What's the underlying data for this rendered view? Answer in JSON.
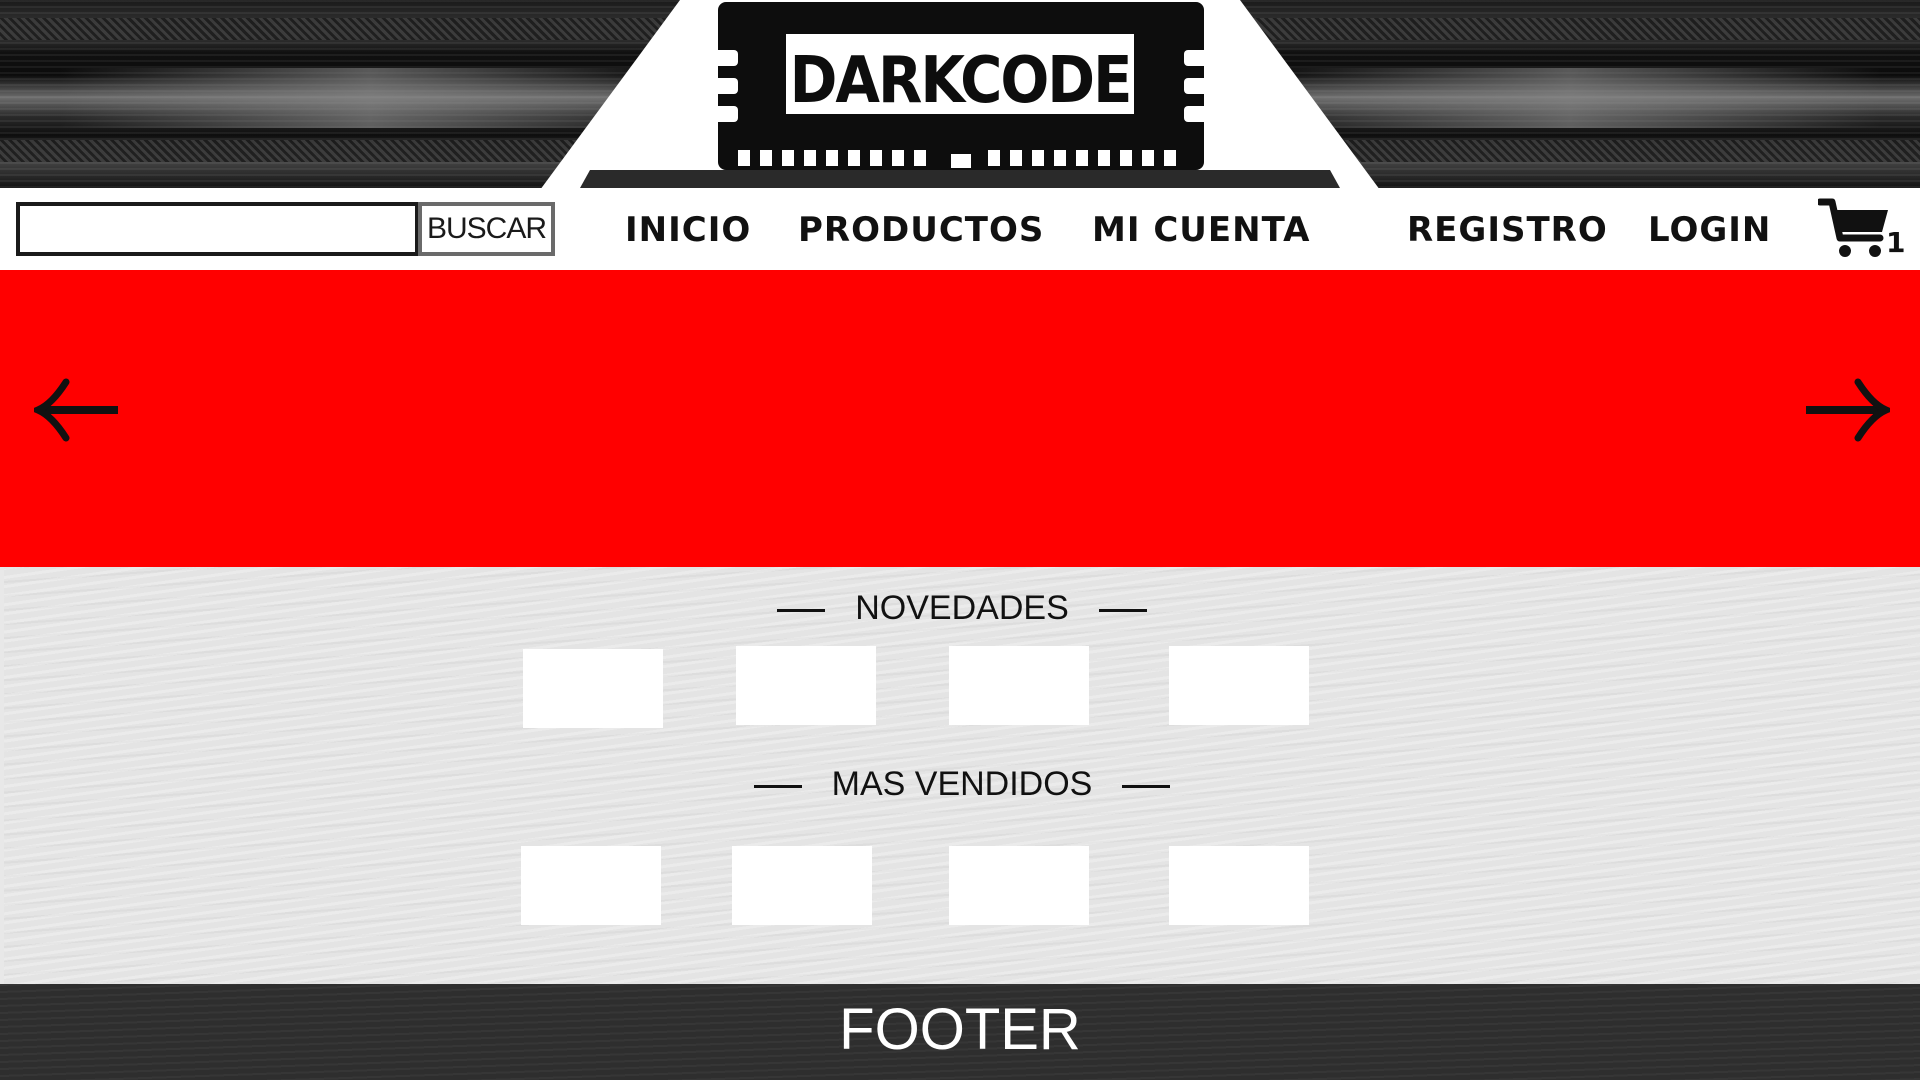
{
  "brand": {
    "name": "DARKCODE"
  },
  "search": {
    "button_label": "BUSCAR",
    "value": "",
    "placeholder": ""
  },
  "nav": {
    "inicio": "INICIO",
    "productos": "PRODUCTOS",
    "mi_cuenta": "MI CUENTA",
    "registro": "REGISTRO",
    "login": "LOGIN"
  },
  "cart": {
    "count": "1",
    "icon": "cart-icon"
  },
  "slider": {
    "color": "#ff0000",
    "prev_icon": "arrow-left-icon",
    "next_icon": "arrow-right-icon"
  },
  "sections": {
    "novedades": {
      "title": "NOVEDADES",
      "product_count_shown": 4
    },
    "mas_vendidos": {
      "title": "MAS VENDIDOS",
      "product_count_shown": 4
    }
  },
  "footer": {
    "text": "FOOTER"
  },
  "colors": {
    "accent": "#ff0000",
    "header_bg": "#1a1a1a",
    "footer_bg": "#2e2e2e",
    "content_bg": "#e4e4e4"
  }
}
